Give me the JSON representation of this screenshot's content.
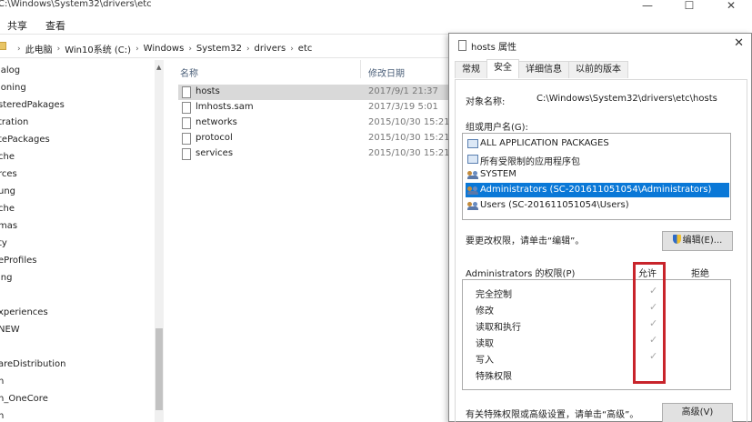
{
  "explorer": {
    "title_path": "C:\\Windows\\System32\\drivers\\etc",
    "window_controls": {
      "minimize": "—",
      "maximize": "☐",
      "close": "✕"
    },
    "ribbon_tabs": [
      "共享",
      "查看"
    ],
    "breadcrumbs": [
      "此电脑",
      "Win10系统 (C:)",
      "Windows",
      "System32",
      "drivers",
      "etc"
    ],
    "nav_items": [
      "ialog",
      "ioning",
      "steredPakages",
      "tration",
      "tePackages",
      "che",
      "rces",
      "ung",
      "che",
      "mas",
      "ty",
      "eProfiles",
      "ing",
      "",
      "xperiences",
      "NEW",
      "",
      "areDistribution",
      "h",
      "h_OneCore",
      "n"
    ],
    "columns": {
      "name": "名称",
      "modified": "修改日期"
    },
    "files": [
      {
        "name": "hosts",
        "date": "2017/9/1 21:37",
        "selected": true
      },
      {
        "name": "lmhosts.sam",
        "date": "2017/3/19 5:01",
        "selected": false
      },
      {
        "name": "networks",
        "date": "2015/10/30 15:21",
        "selected": false
      },
      {
        "name": "protocol",
        "date": "2015/10/30 15:21",
        "selected": false
      },
      {
        "name": "services",
        "date": "2015/10/30 15:21",
        "selected": false
      }
    ]
  },
  "dialog": {
    "title": "hosts 属性",
    "close": "✕",
    "tabs": [
      "常规",
      "安全",
      "详细信息",
      "以前的版本"
    ],
    "active_tab": "安全",
    "object_label": "对象名称:",
    "object_value": "C:\\Windows\\System32\\drivers\\etc\\hosts",
    "groups_label": "组或用户名(G):",
    "users": [
      {
        "name": "ALL APPLICATION PACKAGES",
        "icon": "package-icon",
        "selected": false
      },
      {
        "name": "所有受限制的应用程序包",
        "icon": "package-icon",
        "selected": false
      },
      {
        "name": "SYSTEM",
        "icon": "user-group-icon",
        "selected": false
      },
      {
        "name": "Administrators (SC-201611051054\\Administrators)",
        "icon": "user-group-icon",
        "selected": true
      },
      {
        "name": "Users (SC-201611051054\\Users)",
        "icon": "user-group-icon",
        "selected": false
      }
    ],
    "change_hint": "要更改权限，请单击“编辑”。",
    "edit_button": "编辑(E)...",
    "perm_header": "Administrators 的权限(P)",
    "allow_header": "允许",
    "deny_header": "拒绝",
    "permissions": [
      {
        "name": "完全控制",
        "allow": true,
        "check": "✓"
      },
      {
        "name": "修改",
        "allow": true,
        "check": "✓"
      },
      {
        "name": "读取和执行",
        "allow": true,
        "check": "✓"
      },
      {
        "name": "读取",
        "allow": true,
        "check": "✓"
      },
      {
        "name": "写入",
        "allow": true,
        "check": "✓"
      },
      {
        "name": "特殊权限",
        "allow": false,
        "check": ""
      }
    ],
    "advanced_hint": "有关特殊权限或高级设置，请单击“高级”。",
    "advanced_button": "高级(V)",
    "highlight_color": "#c8242b",
    "selection_color": "#0a78d7"
  }
}
